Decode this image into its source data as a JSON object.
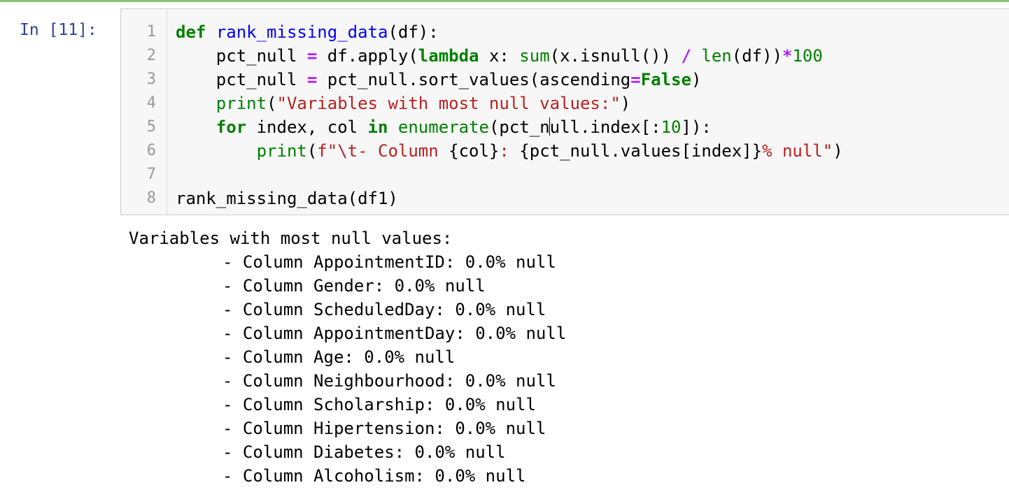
{
  "cell": {
    "prompt": "In [11]:",
    "line_numbers": [
      "1",
      "2",
      "3",
      "4",
      "5",
      "6",
      "7",
      "8"
    ],
    "code": {
      "l1": {
        "kw_def": "def",
        "fn_name": "rank_missing_data",
        "rest": "(df):"
      },
      "l2": {
        "indent": "    ",
        "a": "pct_null ",
        "eq": "=",
        "b": " df.apply(",
        "kw_lambda": "lambda",
        "c": " x: ",
        "bi_sum": "sum",
        "d": "(x.isnull()) ",
        "slash": "/",
        "e": " ",
        "bi_len": "len",
        "f": "(df))",
        "star": "*",
        "num100": "100"
      },
      "l3": {
        "indent": "    ",
        "a": "pct_null ",
        "eq": "=",
        "b": " pct_null.sort_values(ascending",
        "eq2": "=",
        "kw_false": "False",
        "c": ")"
      },
      "l4": {
        "indent": "    ",
        "bi_print": "print",
        "a": "(",
        "str": "\"Variables with most null values:\"",
        "b": ")"
      },
      "l5": {
        "indent": "    ",
        "kw_for": "for",
        "a": " index, col ",
        "kw_in": "in",
        "b": " ",
        "bi_enumerate": "enumerate",
        "c1": "(pct_n",
        "c2": "ull.index[:",
        "num10": "10",
        "d": "]):"
      },
      "l6": {
        "indent": "        ",
        "bi_print": "print",
        "a": "(",
        "str_a": "f\"\\t- Column ",
        "interp1": "{col}",
        "str_b": ": ",
        "interp2": "{pct_null.values[index]}",
        "str_c": "% null\"",
        "b": ")"
      },
      "l7": "",
      "l8": "rank_missing_data(df1)"
    }
  },
  "output": {
    "header": "Variables with most null values:",
    "items": [
      "- Column AppointmentID: 0.0% null",
      "- Column Gender: 0.0% null",
      "- Column ScheduledDay: 0.0% null",
      "- Column AppointmentDay: 0.0% null",
      "- Column Age: 0.0% null",
      "- Column Neighbourhood: 0.0% null",
      "- Column Scholarship: 0.0% null",
      "- Column Hipertension: 0.0% null",
      "- Column Diabetes: 0.0% null",
      "- Column Alcoholism: 0.0% null"
    ]
  },
  "colors": {
    "prompt": "#303f9f",
    "keyword": "#008000",
    "function_def": "#0000ff",
    "operator": "#aa22ff",
    "string": "#ba2121",
    "cell_border_active": "#8ec07c"
  }
}
